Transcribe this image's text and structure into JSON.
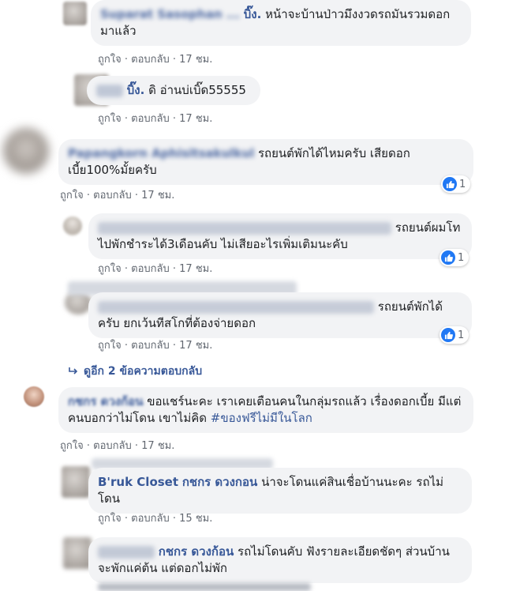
{
  "comments": [
    {
      "name": "Suparat Sasophan ...",
      "name_suffix": "บิ๊ง.",
      "text": "หน้าจะบ้านป่าวมึงงวดรถมันรวมดอกมาแล้ว",
      "like": "ถูกใจ",
      "reply": "ตอบกลับ",
      "time": "17 ชม."
    },
    {
      "name_suffix": "บิ๊ง.",
      "text": "ดิ อ่านบ่เบิ๊ด55555",
      "like": "ถูกใจ",
      "reply": "ตอบกลับ",
      "time": "17 ชม."
    },
    {
      "name": "Papangkorn Aphisitsakulkul",
      "text": "รถยนต์พักได้ไหมครับ เสียดอกเบี้ย100%มั้ยครับ",
      "like": "ถูกใจ",
      "reply": "ตอบกลับ",
      "time": "17 ชม.",
      "reactions": "1"
    },
    {
      "text": "รถยนต์ผมโทไปพักชำระได้3เดือนคับ ไม่เสียอะไรเพิ่มเติมนะคับ",
      "like": "ถูกใจ",
      "reply": "ตอบกลับ",
      "time": "17 ชม.",
      "reactions": "1"
    },
    {
      "text": "รถยนต์พักได้ครับ ยกเว้นทีสโกที่ต้องจ่ายดอก",
      "like": "ถูกใจ",
      "reply": "ตอบกลับ",
      "time": "17 ชม.",
      "reactions": "1"
    },
    {
      "name": "กชกร ดวงก้อน",
      "text": "ขอแชร์นะคะ เราเคยเตือนคนในกลุ่มรถแล้ว เรื่องดอกเบี้ย มีแต่คนบอกว่าไม่โดน เขาไม่คิด",
      "hashtag": "#ของฟรีไม่มีในโลก",
      "like": "ถูกใจ",
      "reply": "ตอบกลับ",
      "time": "17 ชม."
    },
    {
      "name": "B'ruk Closet",
      "mention": "กชกร ดวงกอน",
      "text": "น่าจะโดนแค่สินเชื่อบ้านนะคะ รถไม่โดน",
      "like": "ถูกใจ",
      "reply": "ตอบกลับ",
      "time": "15 ชม."
    },
    {
      "mention": "กชกร ดวงก้อน",
      "text": "รถไม่โดนคับ ฟังรายละเอียดชัดๆ ส่วนบ้านจะพักแค่ต้น แต่ดอกไม่พัก"
    }
  ],
  "view_replies": "ดูอีก 2 ข้อความตอบกลับ",
  "colors": {
    "bubble": "#f2f3f5",
    "name": "#385898",
    "meta": "#616770",
    "like_blue": "#2078f4"
  }
}
